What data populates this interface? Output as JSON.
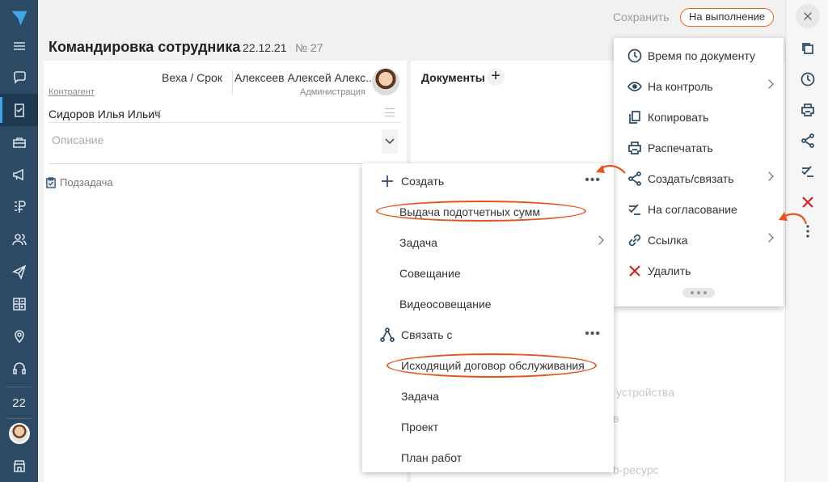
{
  "header": {
    "save_label": "Сохранить",
    "execute_label": "На выполнение",
    "title": "Командировка сотрудника",
    "date": "22.12.21",
    "number": "№ 27"
  },
  "task_card": {
    "milestone_label": "Веха / Срок",
    "person_name": "Алексеев Алексей Алекс...",
    "person_department": "Администрация",
    "counterparty_label": "Контрагент",
    "counterparty_value": "Сидоров Илья Ильич",
    "description_placeholder": "Описание",
    "subtask_label": "Подзадача"
  },
  "documents": {
    "title": "Документы"
  },
  "background_fragments": {
    "devices": "устройства",
    "v": "в",
    "web_resource": "b-ресурс"
  },
  "nav": {
    "date_number": "22",
    "items": [
      "menu-icon",
      "chat-icon",
      "tasks-icon",
      "briefcase-icon",
      "megaphone-icon",
      "ruble-icon",
      "people-icon",
      "send-icon",
      "calculator-icon",
      "map-pin-icon",
      "headset-icon",
      "calendar-date",
      "user-avatar",
      "store-icon"
    ]
  },
  "create_menu": {
    "create_label": "Создать",
    "create_items": [
      {
        "label": "Выдача подотчетных сумм",
        "highlighted": true
      },
      {
        "label": "Задача",
        "has_submenu": true
      },
      {
        "label": "Совещание"
      },
      {
        "label": "Видеосовещание"
      }
    ],
    "link_label": "Связать с",
    "link_items": [
      {
        "label": "Исходящий договор обслуживания",
        "highlighted": true
      },
      {
        "label": "Задача"
      },
      {
        "label": "Проект"
      },
      {
        "label": "План работ"
      }
    ]
  },
  "actions_menu": {
    "items": [
      {
        "label": "Время по документу",
        "icon": "clock-icon"
      },
      {
        "label": "На контроль",
        "icon": "eye-icon",
        "has_submenu": true
      },
      {
        "label": "Копировать",
        "icon": "copy-icon"
      },
      {
        "label": "Распечатать",
        "icon": "printer-icon"
      },
      {
        "label": "Создать/связать",
        "icon": "share-icon",
        "has_submenu": true
      },
      {
        "label": "На согласование",
        "icon": "approve-icon"
      },
      {
        "label": "Ссылка",
        "icon": "link-icon",
        "has_submenu": true
      },
      {
        "label": "Удалить",
        "icon": "delete-icon"
      }
    ]
  },
  "colors": {
    "nav_bg": "#2c4a63",
    "accent_orange": "#e8531c",
    "delete_red": "#d0232a"
  }
}
